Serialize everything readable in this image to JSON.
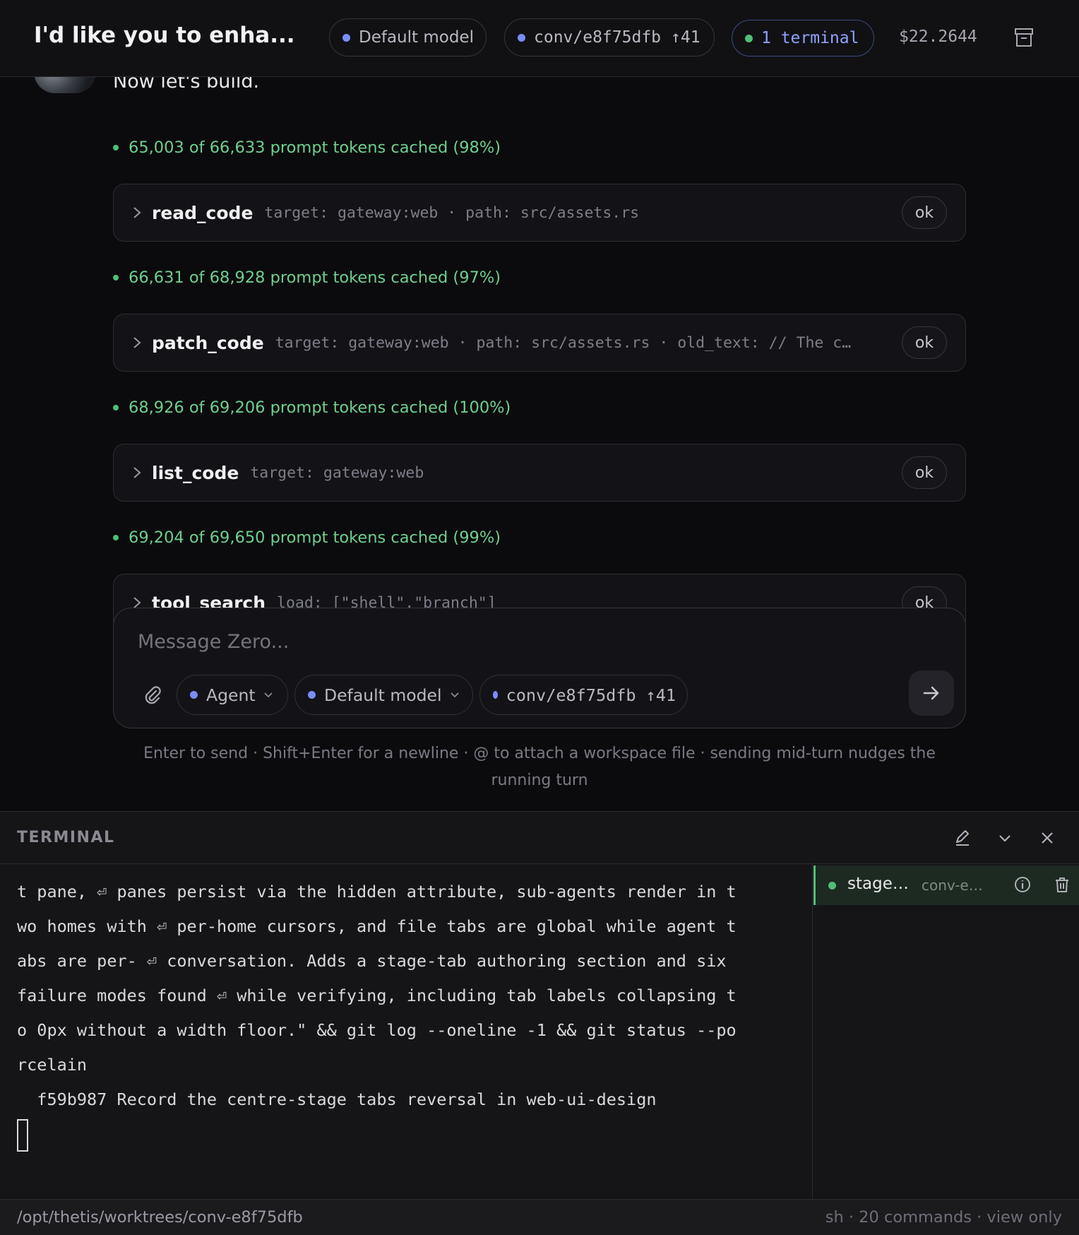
{
  "header": {
    "title": "I'd like you to enha...",
    "model_label": "Default model",
    "conv_label": "conv/e8f75dfb",
    "conv_count": "↑41",
    "terminal_label": "1 terminal",
    "cost": "$22.2644",
    "archive_icon": "archive-icon"
  },
  "chat": {
    "message_text": "Now let's build.",
    "timeline": [
      {
        "cache": "65,003 of 66,633 prompt tokens cached (98%)",
        "tool_name": "read_code",
        "tool_args": "target: gateway:web · path: src/assets.rs",
        "status": "ok"
      },
      {
        "cache": "66,631 of 68,928 prompt tokens cached (97%)",
        "tool_name": "patch_code",
        "tool_args": "target: gateway:web · path: src/assets.rs · old_text: // The c…",
        "status": "ok"
      },
      {
        "cache": "68,926 of 69,206 prompt tokens cached (100%)",
        "tool_name": "list_code",
        "tool_args": "target: gateway:web",
        "status": "ok"
      },
      {
        "cache": "69,204 of 69,650 prompt tokens cached (99%)",
        "tool_name": "tool_search",
        "tool_args": "load: [\"shell\",\"branch\"]",
        "status": "ok"
      }
    ]
  },
  "composer": {
    "placeholder": "Message Zero...",
    "mode_label": "Agent",
    "model_label": "Default model",
    "conv_label": "conv/e8f75dfb",
    "conv_count": "↑41",
    "hint": "Enter to send · Shift+Enter for a newline · @ to attach a workspace file · sending mid-turn nudges the running turn"
  },
  "terminal": {
    "title": "TERMINAL",
    "lines": [
      "t pane, ⏎ panes persist via the hidden attribute, sub-agents render in t",
      "wo homes with ⏎ per-home cursors, and file tabs are global while agent t",
      "abs are per- ⏎ conversation. Adds a stage-tab authoring section and six",
      "failure modes found ⏎ while verifying, including tab labels collapsing t",
      "o 0px without a width floor.\" && git log --oneline -1 && git status --po",
      "rcelain",
      "  f59b987 Record the centre-stage tabs reversal in web-ui-design"
    ],
    "session": {
      "name": "stage…",
      "conv": "conv-e…"
    },
    "footer_path": "/opt/thetis/worktrees/conv-e8f75dfb",
    "footer_stats": "sh · 20 commands · view only"
  },
  "colors": {
    "accent": "#7c8cf8",
    "success": "#4fbf77",
    "cache_text": "#6fcf8e",
    "background": "#0b0b0e"
  }
}
